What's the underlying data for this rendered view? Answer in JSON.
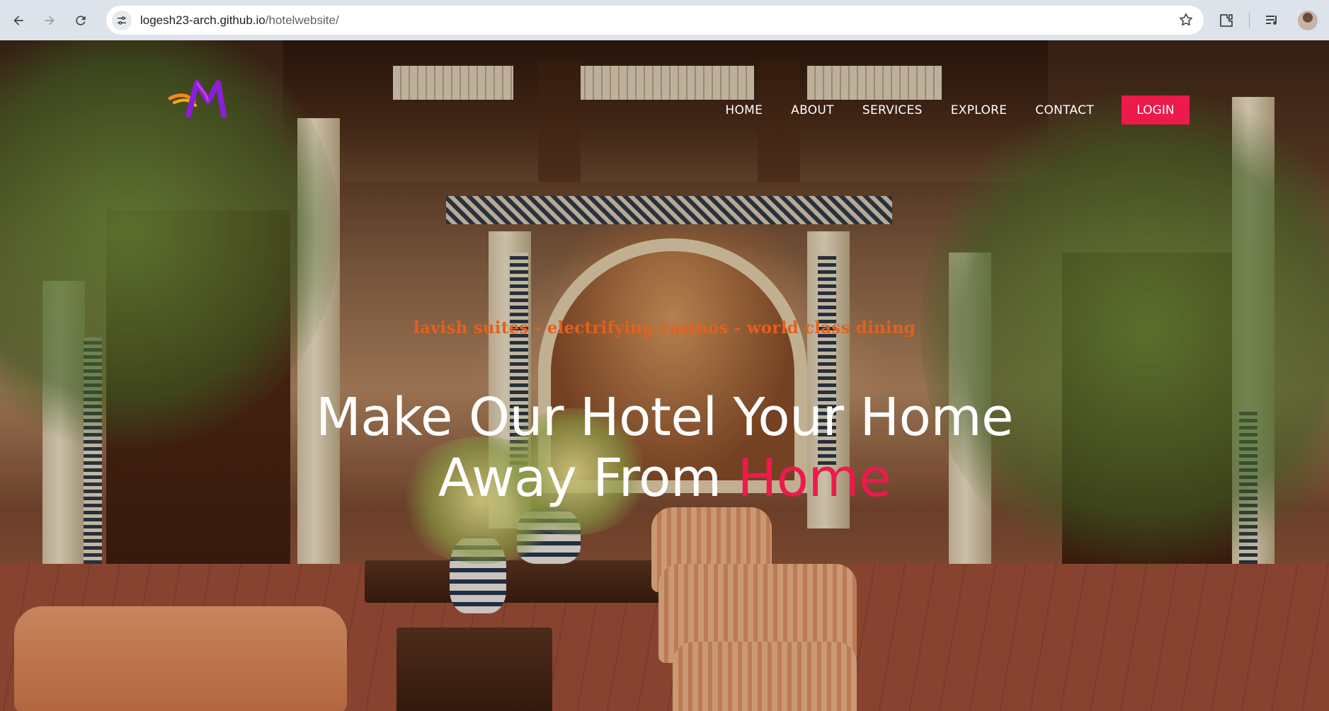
{
  "browser": {
    "url_host": "logesh23-arch.github.io",
    "url_path": "/hotelwebsite/"
  },
  "site": {
    "nav": [
      "HOME",
      "ABOUT",
      "SERVICES",
      "EXPLORE",
      "CONTACT"
    ],
    "login_label": "LOGIN",
    "tagline": "lavish suites - electrifying casinos - world class dining",
    "headline_line1": "Make Our Hotel Your Home",
    "headline_line2_prefix": "Away From ",
    "headline_line2_accent": "Home"
  },
  "colors": {
    "accent": "#ed1a4c",
    "tagline": "#e4611c",
    "chrome_bg": "#dde3ea"
  },
  "icons": [
    "back-icon",
    "forward-icon",
    "reload-icon",
    "site-info-icon",
    "bookmark-star-icon",
    "extensions-icon",
    "media-control-icon",
    "profile-avatar",
    "brand-logo"
  ]
}
